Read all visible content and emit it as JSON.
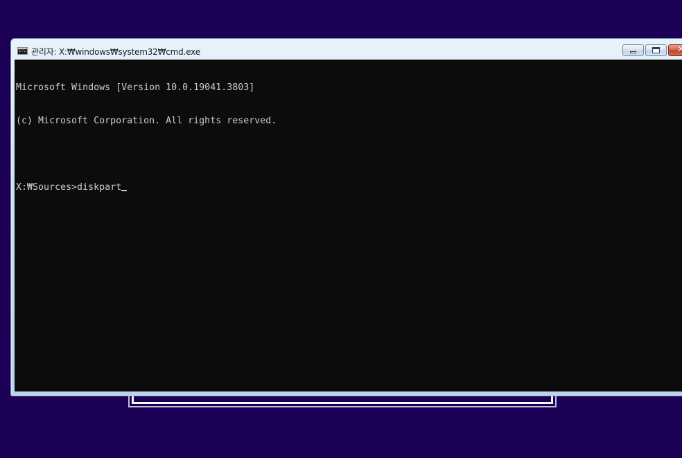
{
  "window": {
    "title": "관리자: X:₩windows₩system32₩cmd.exe",
    "icon": "cmd-console-icon",
    "icon_text": "C:\\."
  },
  "caption_buttons": {
    "minimize": "minimize-icon",
    "maximize": "maximize-icon",
    "close_glyph": "✕"
  },
  "console": {
    "lines": [
      "Microsoft Windows [Version 10.0.19041.3803]",
      "(c) Microsoft Corporation. All rights reserved.",
      "",
      "X:₩Sources>diskpart"
    ]
  },
  "colors": {
    "desktop_background": "#1c0055",
    "console_background": "#0c0c0c",
    "console_text": "#cccccc"
  }
}
